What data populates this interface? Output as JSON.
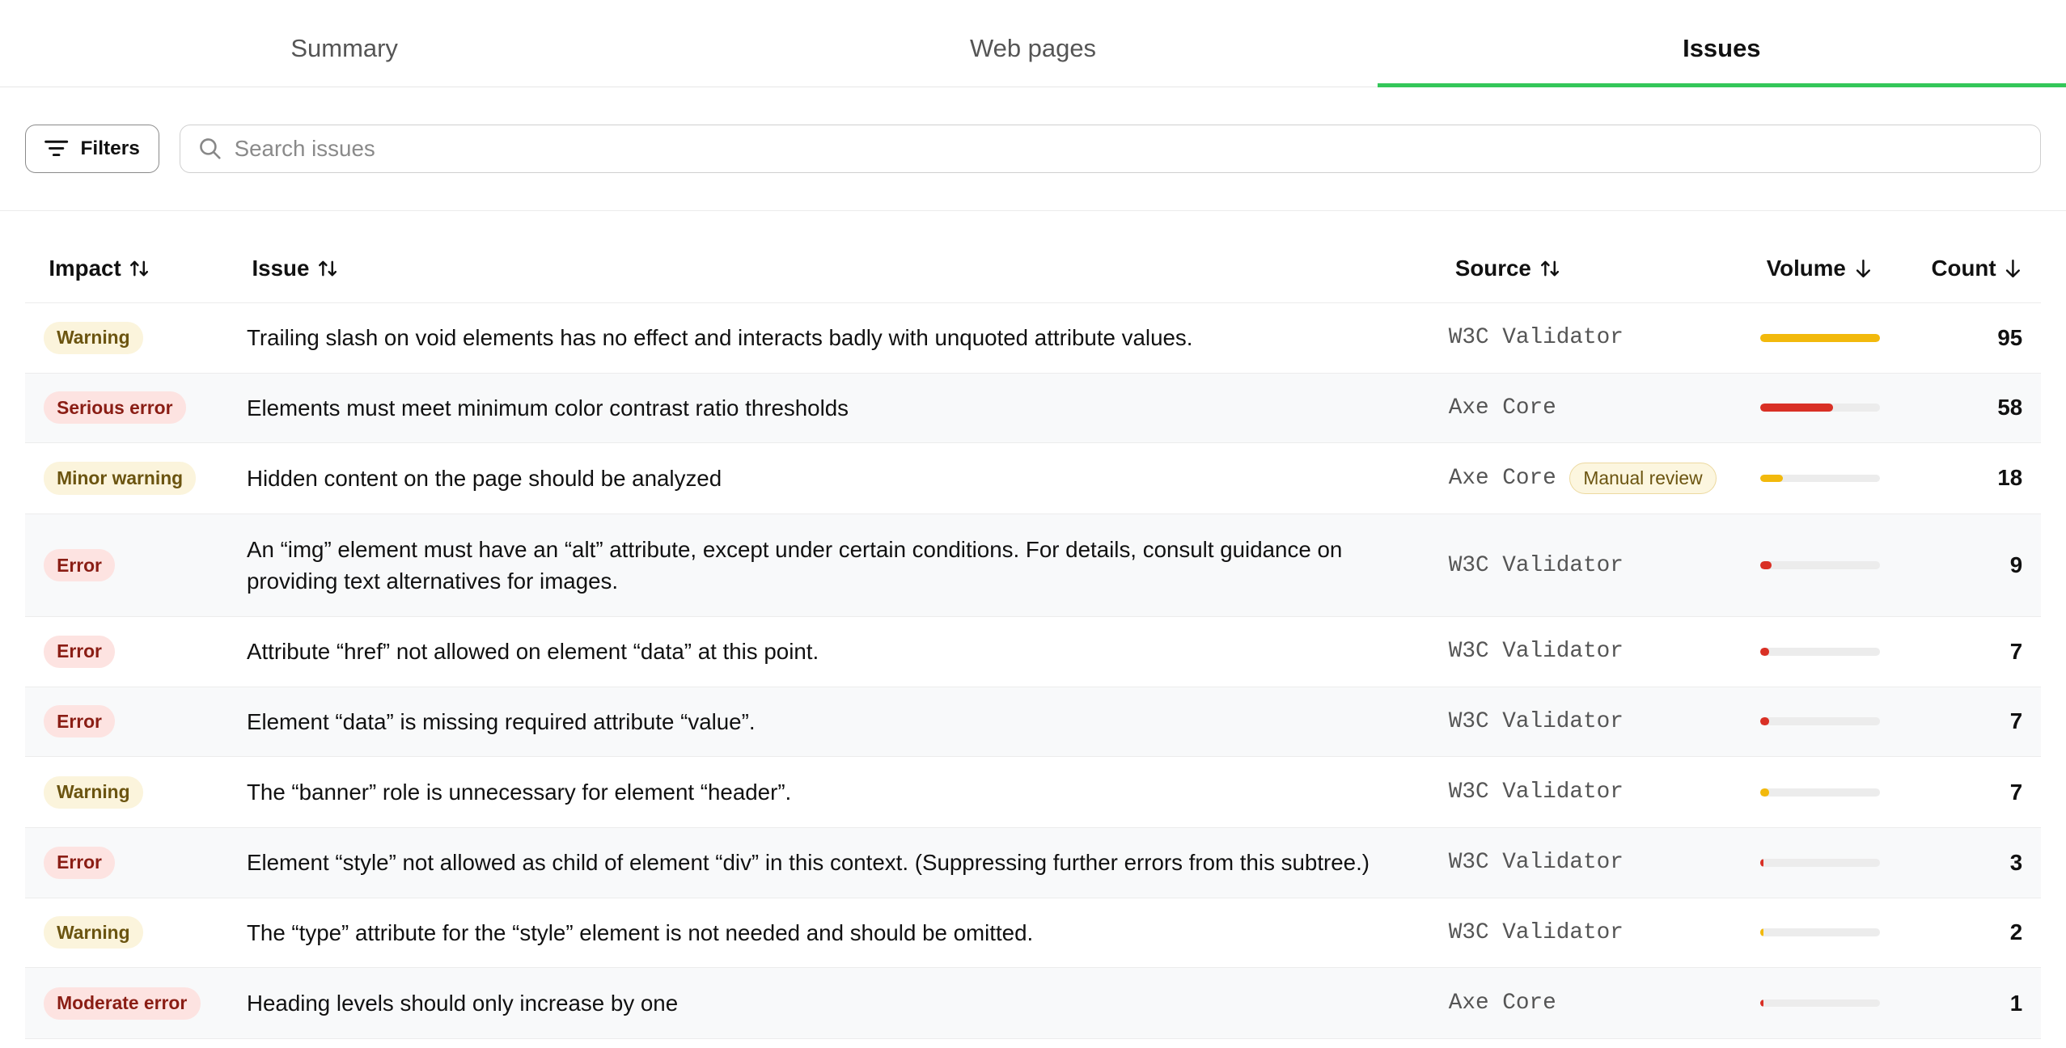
{
  "tabs": [
    {
      "label": "Summary",
      "active": false
    },
    {
      "label": "Web pages",
      "active": false
    },
    {
      "label": "Issues",
      "active": true
    }
  ],
  "accent_color": "#34c759",
  "toolbar": {
    "filters_label": "Filters",
    "filters_icon": "filter-lines-icon",
    "search_icon": "search-icon",
    "search_placeholder": "Search issues",
    "search_value": ""
  },
  "table": {
    "columns": [
      {
        "key": "impact",
        "label": "Impact",
        "sort_icon": "sort-both-icon"
      },
      {
        "key": "issue",
        "label": "Issue",
        "sort_icon": "sort-both-icon"
      },
      {
        "key": "source",
        "label": "Source",
        "sort_icon": "sort-both-icon"
      },
      {
        "key": "volume",
        "label": "Volume",
        "sort_icon": "arrow-down-icon"
      },
      {
        "key": "count",
        "label": "Count",
        "sort_icon": "arrow-down-icon"
      }
    ],
    "max_count": 95,
    "rows": [
      {
        "impact": "Warning",
        "severity": "warning",
        "issue": "Trailing slash on void elements has no effect and interacts badly with unquoted attribute values.",
        "source": "W3C Validator",
        "tag": "",
        "count": 95,
        "color": "#f2b90c"
      },
      {
        "impact": "Serious error",
        "severity": "error",
        "issue": "Elements must meet minimum color contrast ratio thresholds",
        "source": "Axe Core",
        "tag": "",
        "count": 58,
        "color": "#d93025"
      },
      {
        "impact": "Minor warning",
        "severity": "warning",
        "issue": "Hidden content on the page should be analyzed",
        "source": "Axe Core",
        "tag": "Manual review",
        "count": 18,
        "color": "#f2b90c"
      },
      {
        "impact": "Error",
        "severity": "error",
        "issue": "An “img” element must have an “alt” attribute, except under certain conditions. For details, consult guidance on providing text alternatives for images.",
        "source": "W3C Validator",
        "tag": "",
        "count": 9,
        "color": "#d93025"
      },
      {
        "impact": "Error",
        "severity": "error",
        "issue": "Attribute “href” not allowed on element “data” at this point.",
        "source": "W3C Validator",
        "tag": "",
        "count": 7,
        "color": "#d93025"
      },
      {
        "impact": "Error",
        "severity": "error",
        "issue": "Element “data” is missing required attribute “value”.",
        "source": "W3C Validator",
        "tag": "",
        "count": 7,
        "color": "#d93025"
      },
      {
        "impact": "Warning",
        "severity": "warning",
        "issue": "The “banner” role is unnecessary for element “header”.",
        "source": "W3C Validator",
        "tag": "",
        "count": 7,
        "color": "#f2b90c"
      },
      {
        "impact": "Error",
        "severity": "error",
        "issue": "Element “style” not allowed as child of element “div” in this context. (Suppressing further errors from this subtree.)",
        "source": "W3C Validator",
        "tag": "",
        "count": 3,
        "color": "#d93025"
      },
      {
        "impact": "Warning",
        "severity": "warning",
        "issue": "The “type” attribute for the “style” element is not needed and should be omitted.",
        "source": "W3C Validator",
        "tag": "",
        "count": 2,
        "color": "#f2b90c"
      },
      {
        "impact": "Moderate error",
        "severity": "error",
        "issue": "Heading levels should only increase by one",
        "source": "Axe Core",
        "tag": "",
        "count": 1,
        "color": "#d93025"
      }
    ]
  }
}
